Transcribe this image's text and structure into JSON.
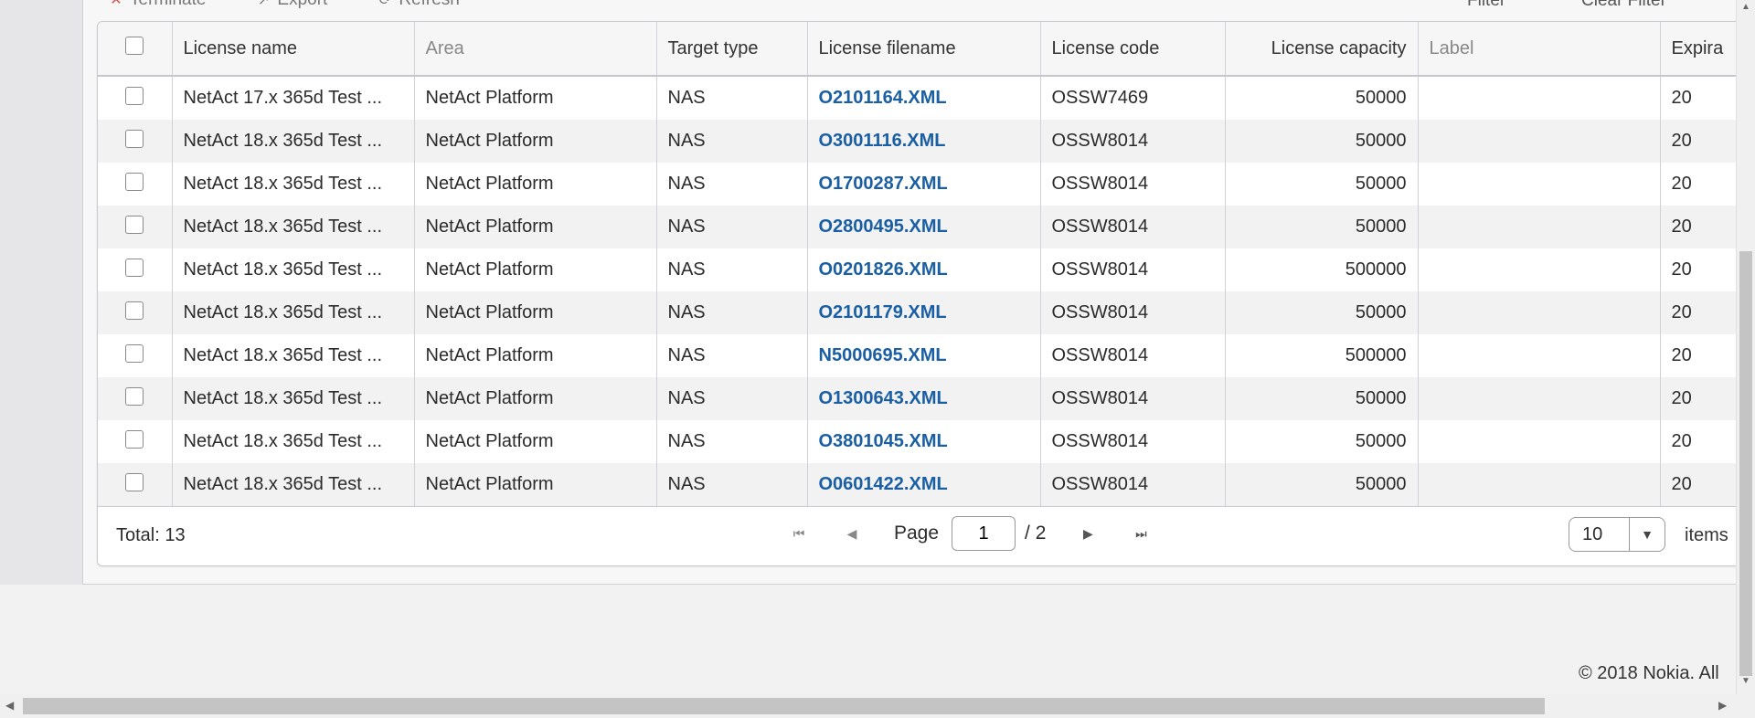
{
  "toolbar": {
    "items": [
      {
        "label": "Terminate",
        "icon": "close-icon"
      },
      {
        "label": "Export",
        "icon": "export-icon"
      },
      {
        "label": "Refresh",
        "icon": "refresh-icon"
      }
    ],
    "filter_label": "Filter",
    "clear_filter_label": "Clear Filter"
  },
  "table": {
    "columns": [
      "License name",
      "Area",
      "Target type",
      "License filename",
      "License code",
      "License capacity",
      "Label",
      "Expira"
    ],
    "rows": [
      [
        "NetAct 17.x 365d Test ...",
        "NetAct Platform",
        "NAS",
        "O2101164.XML",
        "OSSW7469",
        "50000",
        "",
        "20"
      ],
      [
        "NetAct 18.x 365d Test ...",
        "NetAct Platform",
        "NAS",
        "O3001116.XML",
        "OSSW8014",
        "50000",
        "",
        "20"
      ],
      [
        "NetAct 18.x 365d Test ...",
        "NetAct Platform",
        "NAS",
        "O1700287.XML",
        "OSSW8014",
        "50000",
        "",
        "20"
      ],
      [
        "NetAct 18.x 365d Test ...",
        "NetAct Platform",
        "NAS",
        "O2800495.XML",
        "OSSW8014",
        "50000",
        "",
        "20"
      ],
      [
        "NetAct 18.x 365d Test ...",
        "NetAct Platform",
        "NAS",
        "O0201826.XML",
        "OSSW8014",
        "500000",
        "",
        "20"
      ],
      [
        "NetAct 18.x 365d Test ...",
        "NetAct Platform",
        "NAS",
        "O2101179.XML",
        "OSSW8014",
        "50000",
        "",
        "20"
      ],
      [
        "NetAct 18.x 365d Test ...",
        "NetAct Platform",
        "NAS",
        "N5000695.XML",
        "OSSW8014",
        "500000",
        "",
        "20"
      ],
      [
        "NetAct 18.x 365d Test ...",
        "NetAct Platform",
        "NAS",
        "O1300643.XML",
        "OSSW8014",
        "50000",
        "",
        "20"
      ],
      [
        "NetAct 18.x 365d Test ...",
        "NetAct Platform",
        "NAS",
        "O3801045.XML",
        "OSSW8014",
        "50000",
        "",
        "20"
      ],
      [
        "NetAct 18.x 365d Test ...",
        "NetAct Platform",
        "NAS",
        "O0601422.XML",
        "OSSW8014",
        "50000",
        "",
        "20"
      ]
    ]
  },
  "footer": {
    "total": "Total: 13",
    "page_label": "Page",
    "current_page": "1",
    "page_count": "/ 2",
    "page_size": "10",
    "items_label": "items"
  },
  "copyright": "© 2018 Nokia. All",
  "colors": {
    "link": "#1a5fa3",
    "alt_row": "#f2f2f2"
  }
}
